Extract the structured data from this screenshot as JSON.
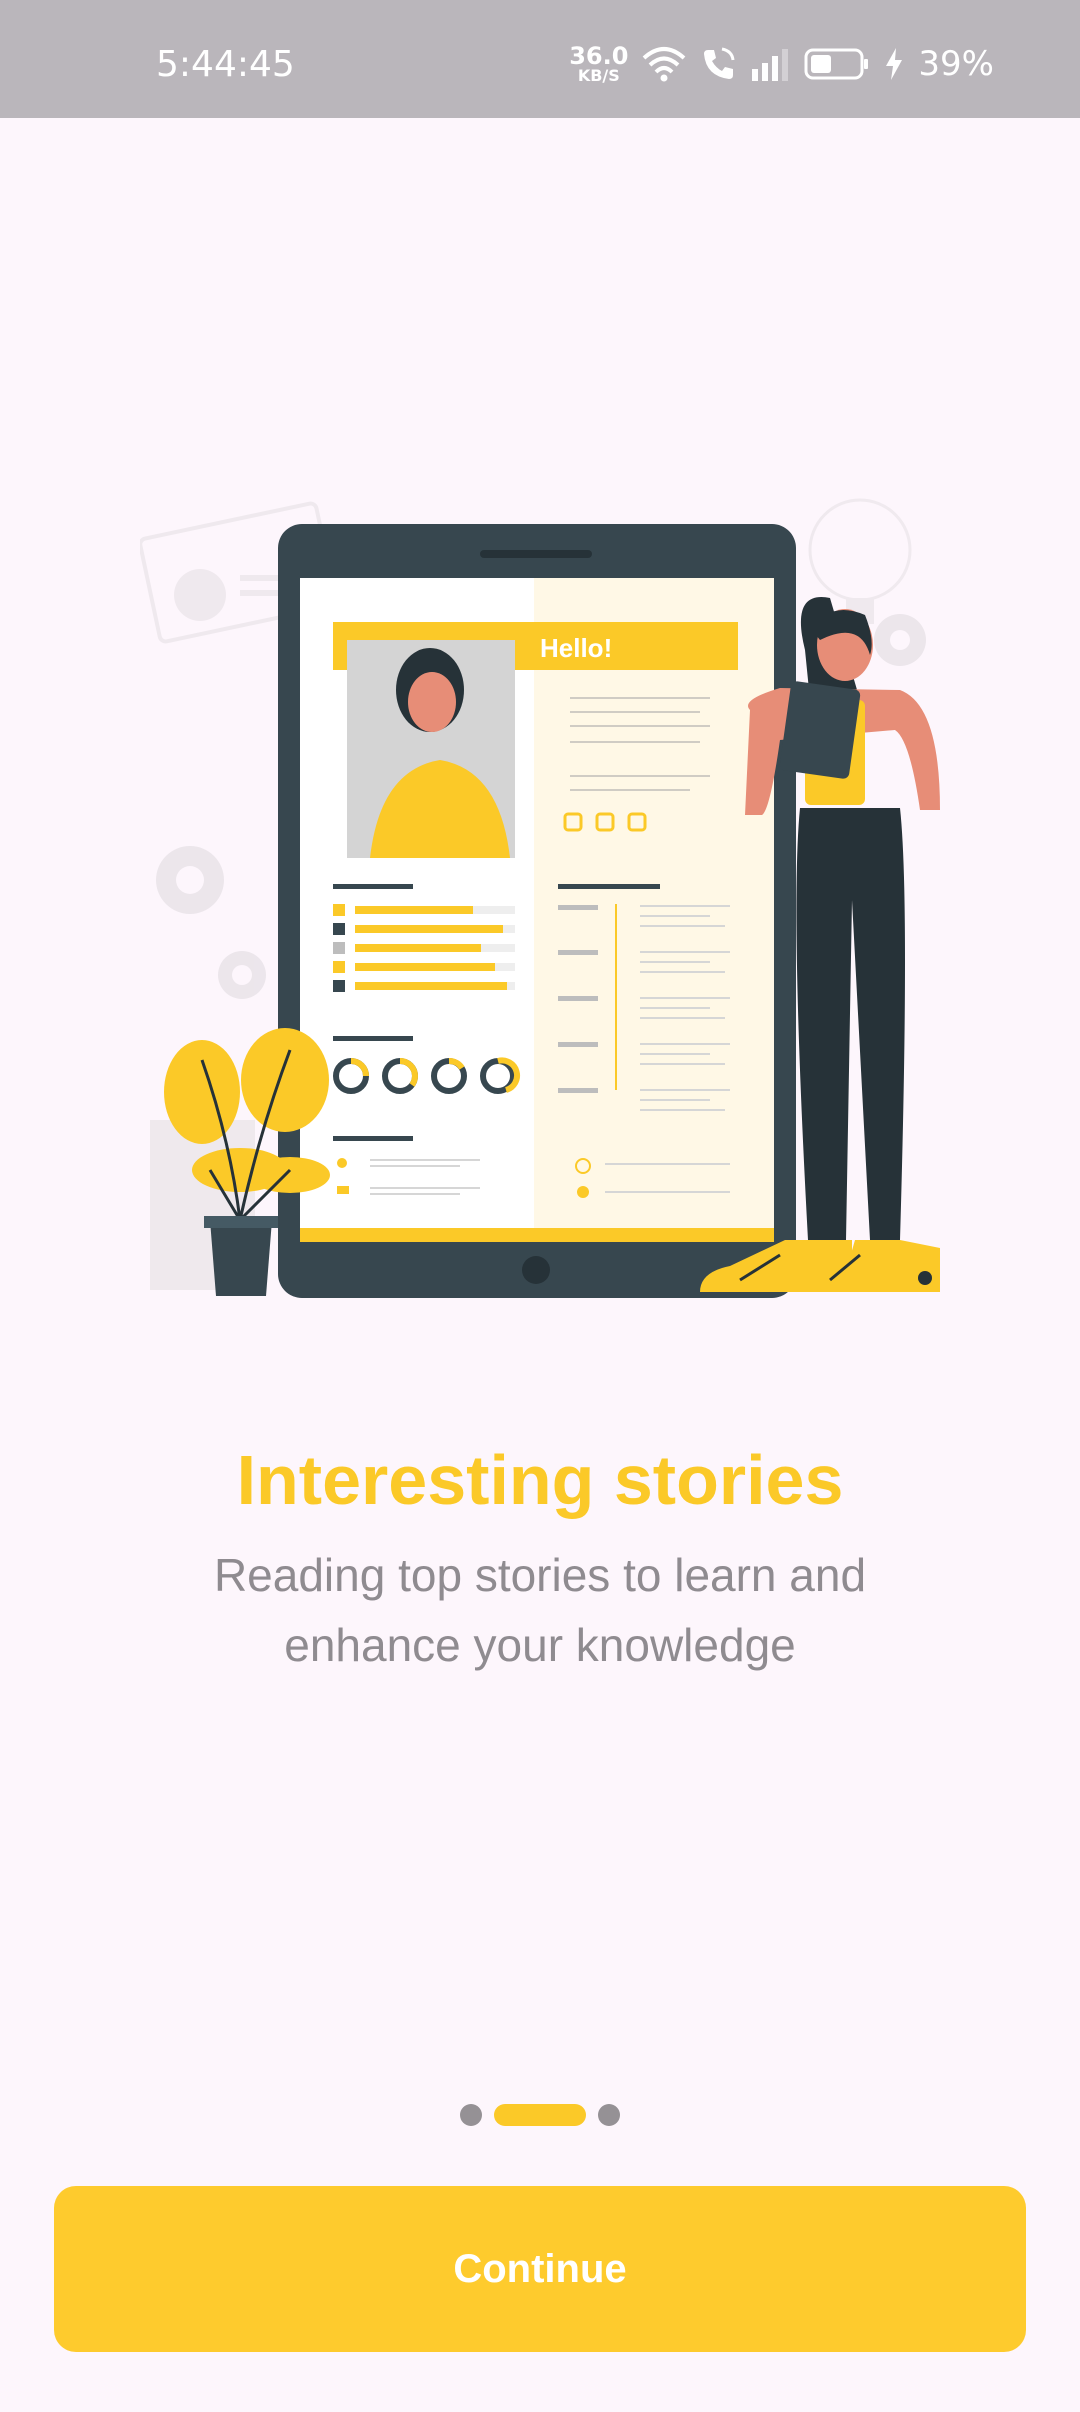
{
  "status_bar": {
    "time": "5:44:45",
    "net_speed_value": "36.0",
    "net_speed_unit": "KB/S",
    "battery_percent": "39%"
  },
  "illustration": {
    "banner_text": "Hello!"
  },
  "onboarding": {
    "title": "Interesting stories",
    "subtitle": "Reading top stories to learn and enhance your knowledge"
  },
  "pager": {
    "page_count": 3,
    "active_index": 1
  },
  "actions": {
    "continue_label": "Continue"
  },
  "colors": {
    "accent": "#fbc928",
    "background": "#fdf6fc",
    "status_bar": "#bab6bb",
    "subtitle_text": "#8f8b90",
    "dark": "#37474f"
  }
}
